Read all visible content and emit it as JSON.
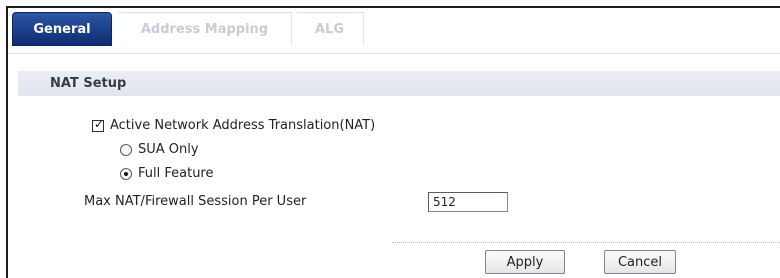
{
  "tabs": [
    {
      "label": "General",
      "active": true
    },
    {
      "label": "Address Mapping",
      "active": false
    },
    {
      "label": "ALG",
      "active": false
    }
  ],
  "section": {
    "title": "NAT Setup"
  },
  "nat": {
    "active_label": "Active Network Address Translation(NAT)",
    "active_checked": true,
    "modes": [
      {
        "label": "SUA Only",
        "selected": false
      },
      {
        "label": "Full Feature",
        "selected": true
      }
    ]
  },
  "session": {
    "label": "Max NAT/Firewall Session Per User",
    "value": "512"
  },
  "actions": {
    "apply_label": "Apply",
    "cancel_label": "Cancel"
  },
  "colors": {
    "tab_active": "#1a3c8c",
    "section_bg": "#e6e9ee"
  }
}
